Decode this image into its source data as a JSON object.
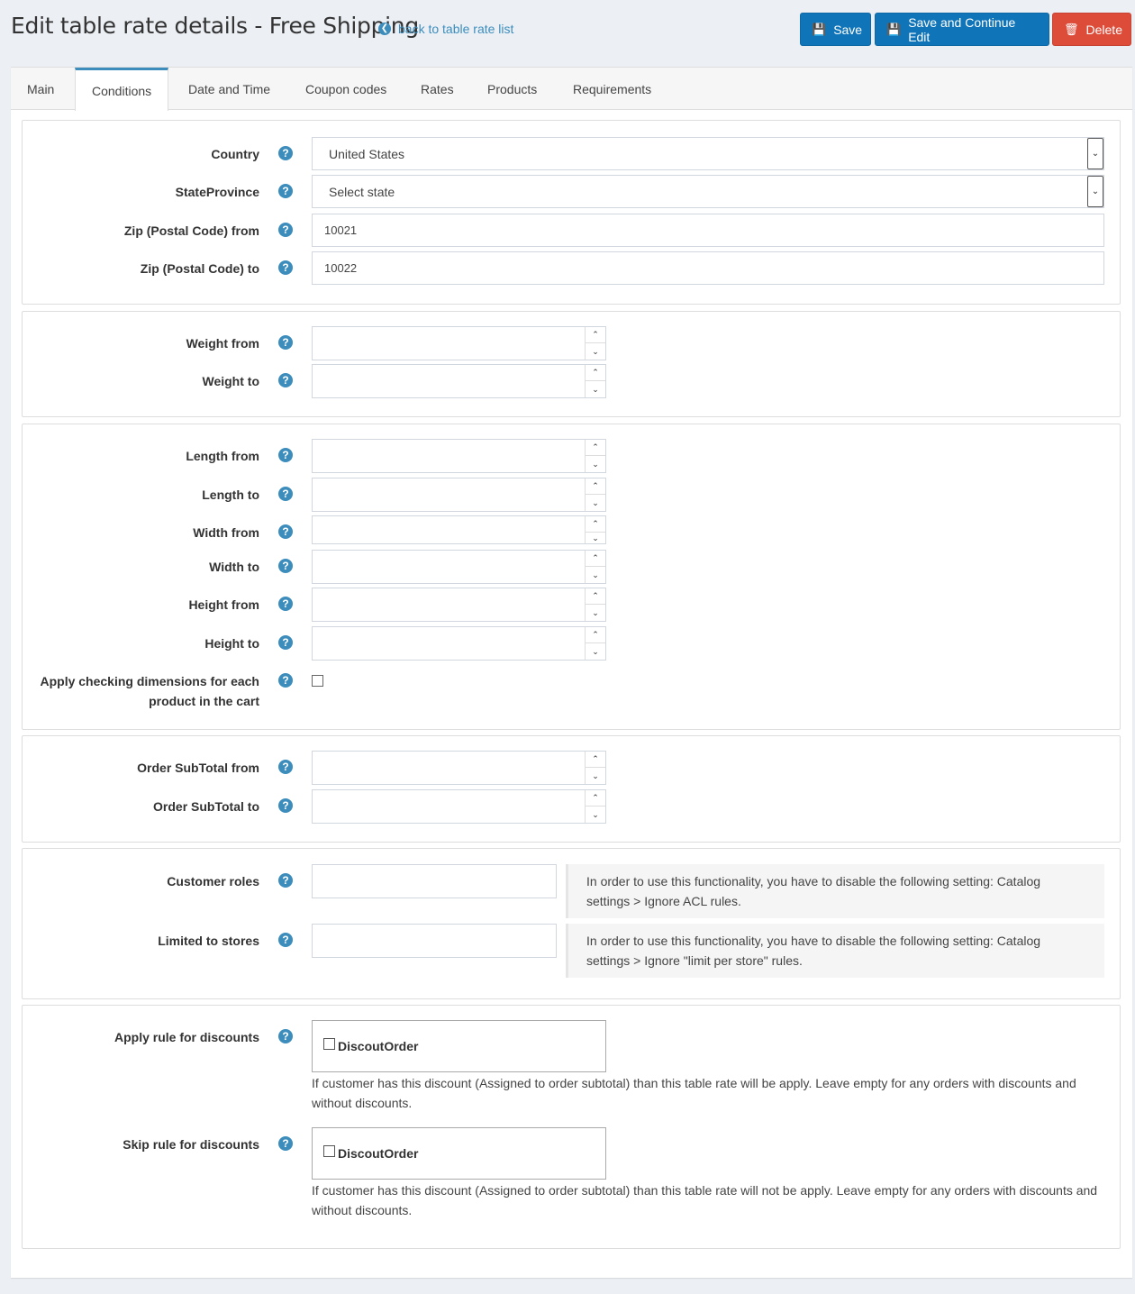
{
  "header": {
    "title": "Edit table rate details - Free Shipping",
    "back_link": "back to table rate list",
    "save": "Save",
    "save_continue": "Save and Continue Edit",
    "delete": "Delete"
  },
  "tabs": [
    "Main",
    "Conditions",
    "Date and Time",
    "Coupon codes",
    "Rates",
    "Products",
    "Requirements"
  ],
  "active_tab": "Conditions",
  "location": {
    "country_label": "Country",
    "country_value": "United States",
    "state_label": "StateProvince",
    "state_value": "Select state",
    "zip_from_label": "Zip (Postal Code) from",
    "zip_from_value": "10021",
    "zip_to_label": "Zip (Postal Code) to",
    "zip_to_value": "10022"
  },
  "weight": {
    "from_label": "Weight from",
    "to_label": "Weight to"
  },
  "dimensions": {
    "length_from": "Length from",
    "length_to": "Length to",
    "width_from": "Width from",
    "width_to": "Width to",
    "height_from": "Height from",
    "height_to": "Height to",
    "apply_each_line1": "Apply checking dimensions for each",
    "apply_each_line2": "product in the cart"
  },
  "subtotal": {
    "from_label": "Order SubTotal from",
    "to_label": "Order SubTotal to"
  },
  "acl": {
    "roles_label": "Customer roles",
    "roles_note": "In order to use this functionality, you have to disable the following setting: Catalog settings > Ignore ACL rules.",
    "stores_label": "Limited to stores",
    "stores_note": "In order to use this functionality, you have to disable the following setting: Catalog settings > Ignore \"limit per store\" rules."
  },
  "discounts": {
    "apply_label": "Apply rule for discounts",
    "apply_option": "DiscoutOrder",
    "apply_hint": "If customer has this discount (Assigned to order subtotal) than this table rate will be apply. Leave empty for any orders with discounts and without discounts.",
    "skip_label": "Skip rule for discounts",
    "skip_option": "DiscoutOrder",
    "skip_hint": "If customer has this discount (Assigned to order subtotal) than this table rate will not be apply. Leave empty for any orders with discounts and without discounts."
  },
  "icons": {
    "help": "question-circle-icon",
    "save": "floppy-icon",
    "delete": "trash-icon",
    "back": "arrow-circle-left-icon"
  },
  "colors": {
    "primary": "#0f74b8",
    "danger": "#dd4b39",
    "link": "#3c8dbc"
  }
}
